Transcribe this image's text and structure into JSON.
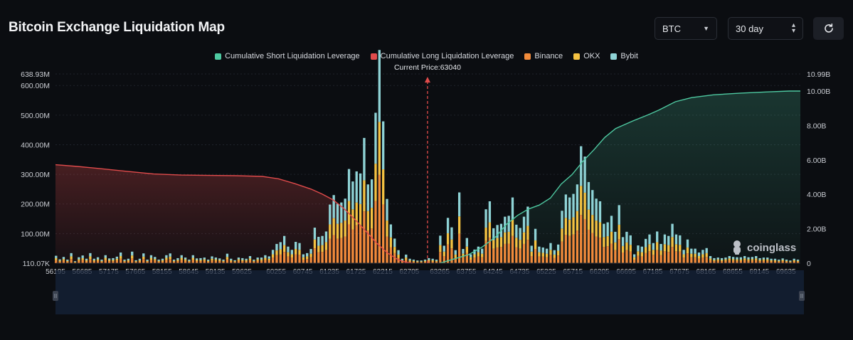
{
  "title": "Bitcoin Exchange Liquidation Map",
  "controls": {
    "coin": "BTC",
    "period": "30 day"
  },
  "colors": {
    "short": "#4ec9a1",
    "long": "#e04b4b",
    "binance": "#f28b3b",
    "okx": "#f5c242",
    "bybit": "#8fd3d6",
    "current_price_line": "#e04b4b",
    "background": "#0b0d11"
  },
  "icons": {
    "refresh": "refresh-icon",
    "dropdown": "chevron-down-icon",
    "stepper": "up-down-icon",
    "watermark": "coinglass-logo"
  },
  "watermark": "coinglass",
  "chart_data": {
    "type": "bar",
    "xlabel": "",
    "ylabel": "",
    "ylim": [
      110070,
      638930000
    ],
    "y2lim": [
      0,
      10990000000
    ],
    "y_ticks": [
      "110.07K",
      "100.00M",
      "200.00M",
      "300.00M",
      "400.00M",
      "500.00M",
      "600.00M",
      "638.93M"
    ],
    "y2_ticks": [
      "0",
      "2.00B",
      "4.00B",
      "6.00B",
      "8.00B",
      "10.00B",
      "10.99B"
    ],
    "x_ticks": [
      "56195",
      "56685",
      "57175",
      "57665",
      "58155",
      "58645",
      "59135",
      "59625",
      "60255",
      "60745",
      "61235",
      "61725",
      "62215",
      "62705",
      "63265",
      "63755",
      "64245",
      "64735",
      "65225",
      "65715",
      "66205",
      "66695",
      "67185",
      "67675",
      "68165",
      "68655",
      "69145",
      "69635"
    ],
    "x_range": [
      56195,
      69900
    ],
    "current_price": 63040,
    "current_price_label": "Current Price:63040",
    "grid": true,
    "legend_position": "top-center",
    "legend": [
      "Cumulative Short Liquidation Leverage",
      "Cumulative Long Liquidation Leverage",
      "Binance",
      "OKX",
      "Bybit"
    ],
    "bars": {
      "bin_width": 70,
      "x": [
        56205,
        56275,
        56345,
        56415,
        56485,
        56555,
        56625,
        56695,
        56765,
        56835,
        56905,
        56975,
        57045,
        57115,
        57185,
        57255,
        57325,
        57395,
        57465,
        57535,
        57605,
        57675,
        57745,
        57815,
        57885,
        57955,
        58025,
        58095,
        58165,
        58235,
        58305,
        58375,
        58445,
        58515,
        58585,
        58655,
        58725,
        58795,
        58865,
        58935,
        59005,
        59075,
        59145,
        59215,
        59285,
        59355,
        59425,
        59495,
        59565,
        59635,
        59705,
        59775,
        59845,
        59915,
        59985,
        60055,
        60125,
        60195,
        60265,
        60335,
        60405,
        60475,
        60545,
        60615,
        60685,
        60755,
        60825,
        60895,
        60965,
        61035,
        61105,
        61175,
        61245,
        61315,
        61385,
        61455,
        61525,
        61595,
        61665,
        61735,
        61805,
        61875,
        61945,
        62015,
        62085,
        62155,
        62225,
        62295,
        62365,
        62435,
        62505,
        62575,
        62645,
        62715,
        62785,
        62855,
        62925,
        62995,
        63065,
        63135,
        63205,
        63275,
        63345,
        63415,
        63485,
        63555,
        63625,
        63695,
        63765,
        63835,
        63905,
        63975,
        64045,
        64115,
        64185,
        64255,
        64325,
        64395,
        64465,
        64535,
        64605,
        64675,
        64745,
        64815,
        64885,
        64955,
        65025,
        65095,
        65165,
        65235,
        65305,
        65375,
        65445,
        65515,
        65585,
        65655,
        65725,
        65795,
        65865,
        65935,
        66005,
        66075,
        66145,
        66215,
        66285,
        66355,
        66425,
        66495,
        66565,
        66635,
        66705,
        66775,
        66845,
        66915,
        66985,
        67055,
        67125,
        67195,
        67265,
        67335,
        67405,
        67475,
        67545,
        67615,
        67685,
        67755,
        67825,
        67895,
        67965,
        68035,
        68105,
        68175,
        68245,
        68315,
        68385,
        68455,
        68525,
        68595,
        68665,
        68735,
        68805,
        68875,
        68945,
        69015,
        69085,
        69155,
        69225,
        69295,
        69365,
        69435,
        69505,
        69575,
        69645,
        69715,
        69785,
        69855
      ],
      "series": [
        {
          "name": "Binance",
          "values": [
            10,
            5,
            9,
            5,
            14,
            3,
            8,
            11,
            6,
            14,
            6,
            8,
            5,
            11,
            7,
            7,
            9,
            15,
            5,
            6,
            16,
            4,
            6,
            14,
            5,
            11,
            9,
            5,
            6,
            11,
            14,
            5,
            7,
            11,
            8,
            5,
            11,
            7,
            7,
            8,
            5,
            9,
            8,
            7,
            5,
            13,
            6,
            4,
            8,
            7,
            6,
            10,
            5,
            8,
            8,
            11,
            9,
            19,
            27,
            29,
            38,
            23,
            19,
            30,
            28,
            12,
            14,
            20,
            50,
            37,
            38,
            44,
            82,
            95,
            83,
            85,
            90,
            131,
            114,
            128,
            125,
            175,
            110,
            117,
            210,
            298,
            198,
            90,
            54,
            34,
            18,
            6,
            12,
            6,
            5,
            4,
            4,
            5,
            7,
            6,
            5,
            38,
            24,
            63,
            50,
            18,
            99,
            20,
            35,
            12,
            19,
            23,
            20,
            75,
            86,
            49,
            53,
            55,
            65,
            66,
            92,
            54,
            49,
            65,
            79,
            24,
            48,
            23,
            22,
            20,
            28,
            18,
            26,
            73,
            96,
            92,
            97,
            110,
            163,
            149,
            113,
            102,
            90,
            86,
            55,
            57,
            66,
            44,
            81,
            36,
            44,
            39,
            12,
            25,
            23,
            34,
            40,
            28,
            44,
            27,
            40,
            38,
            55,
            40,
            39,
            19,
            33,
            20,
            20,
            15,
            19,
            21,
            10,
            7,
            8,
            7,
            8,
            10,
            9,
            8,
            8,
            10,
            8,
            9,
            10,
            7,
            8,
            8,
            6,
            6,
            5,
            7,
            5,
            4,
            6,
            5,
            6,
            5
          ]
        },
        {
          "name": "OKX",
          "values": [
            7,
            4,
            5,
            3,
            9,
            2,
            5,
            6,
            4,
            9,
            4,
            5,
            3,
            7,
            4,
            4,
            6,
            9,
            3,
            4,
            10,
            3,
            4,
            8,
            3,
            7,
            5,
            3,
            4,
            7,
            8,
            3,
            4,
            7,
            5,
            3,
            7,
            4,
            4,
            5,
            3,
            6,
            5,
            4,
            3,
            8,
            4,
            3,
            5,
            4,
            4,
            6,
            3,
            5,
            5,
            7,
            6,
            11,
            16,
            18,
            23,
            14,
            11,
            18,
            17,
            8,
            9,
            12,
            30,
            22,
            23,
            27,
            49,
            57,
            50,
            51,
            54,
            79,
            68,
            77,
            75,
            105,
            66,
            70,
            126,
            179,
            119,
            54,
            33,
            21,
            11,
            4,
            7,
            4,
            3,
            2,
            2,
            3,
            4,
            4,
            3,
            23,
            15,
            38,
            30,
            11,
            59,
            12,
            21,
            8,
            11,
            14,
            12,
            45,
            52,
            29,
            32,
            33,
            39,
            40,
            55,
            32,
            30,
            39,
            47,
            15,
            29,
            14,
            13,
            12,
            17,
            11,
            16,
            44,
            57,
            55,
            58,
            66,
            98,
            89,
            68,
            61,
            54,
            52,
            33,
            34,
            40,
            26,
            49,
            22,
            26,
            23,
            8,
            15,
            14,
            20,
            24,
            17,
            27,
            16,
            24,
            23,
            33,
            24,
            23,
            11,
            20,
            12,
            12,
            9,
            11,
            13,
            6,
            4,
            5,
            4,
            5,
            6,
            5,
            5,
            5,
            6,
            5,
            5,
            6,
            4,
            5,
            5,
            4,
            4,
            3,
            4,
            3,
            2,
            4,
            3,
            3,
            3
          ]
        },
        {
          "name": "Bybit",
          "values": [
            8,
            4,
            7,
            4,
            11,
            2,
            7,
            9,
            5,
            11,
            5,
            7,
            4,
            9,
            5,
            6,
            7,
            12,
            4,
            5,
            13,
            3,
            5,
            11,
            4,
            9,
            7,
            4,
            5,
            9,
            11,
            4,
            6,
            9,
            6,
            4,
            9,
            5,
            6,
            6,
            4,
            8,
            6,
            5,
            4,
            11,
            5,
            3,
            6,
            6,
            5,
            8,
            4,
            6,
            6,
            9,
            8,
            15,
            22,
            24,
            31,
            19,
            15,
            24,
            23,
            10,
            11,
            16,
            40,
            30,
            31,
            36,
            67,
            78,
            68,
            69,
            74,
            108,
            94,
            105,
            103,
            143,
            90,
            96,
            172,
            243,
            162,
            73,
            44,
            28,
            15,
            5,
            10,
            5,
            4,
            3,
            3,
            4,
            6,
            5,
            4,
            32,
            20,
            52,
            41,
            15,
            81,
            16,
            29,
            10,
            16,
            19,
            17,
            62,
            71,
            40,
            44,
            45,
            53,
            54,
            75,
            44,
            40,
            53,
            65,
            20,
            39,
            19,
            18,
            17,
            23,
            15,
            21,
            60,
            79,
            75,
            79,
            90,
            134,
            122,
            93,
            84,
            74,
            71,
            45,
            47,
            54,
            36,
            66,
            30,
            36,
            32,
            10,
            20,
            19,
            28,
            33,
            23,
            36,
            22,
            33,
            31,
            45,
            33,
            32,
            15,
            27,
            17,
            17,
            12,
            15,
            17,
            8,
            6,
            6,
            6,
            6,
            8,
            7,
            7,
            7,
            8,
            7,
            7,
            8,
            6,
            6,
            6,
            5,
            5,
            4,
            5,
            4,
            3,
            5,
            4,
            4,
            4
          ]
        }
      ],
      "unit": "M"
    },
    "cumulative_long": {
      "name": "Cumulative Long Liquidation Leverage",
      "x": [
        56195,
        56600,
        57000,
        57500,
        58000,
        58500,
        59000,
        59500,
        60000,
        60300,
        60600,
        60900,
        61100,
        61300,
        61500,
        61700,
        61900,
        62100,
        62300,
        62500,
        62650,
        62760
      ],
      "y": [
        5.72,
        5.62,
        5.5,
        5.34,
        5.18,
        5.12,
        5.1,
        5.08,
        5.04,
        4.9,
        4.62,
        4.3,
        4.02,
        3.68,
        3.18,
        2.55,
        1.88,
        1.18,
        0.6,
        0.2,
        0.05,
        0
      ]
    },
    "cumulative_short": {
      "name": "Cumulative Short Liquidation Leverage",
      "x": [
        63265,
        63500,
        63800,
        64050,
        64300,
        64500,
        64700,
        64900,
        65100,
        65300,
        65500,
        65700,
        65900,
        66100,
        66300,
        66500,
        66800,
        67100,
        67300,
        67600,
        67900,
        68300,
        68800,
        69300,
        69700,
        69900
      ],
      "y": [
        0,
        0.22,
        0.5,
        0.95,
        1.55,
        2.28,
        2.78,
        3.15,
        3.38,
        3.78,
        4.6,
        5.15,
        5.92,
        6.58,
        7.3,
        7.82,
        8.24,
        8.62,
        8.9,
        9.38,
        9.62,
        9.78,
        9.88,
        9.95,
        10.0,
        10.0
      ],
      "unit": "B"
    }
  }
}
